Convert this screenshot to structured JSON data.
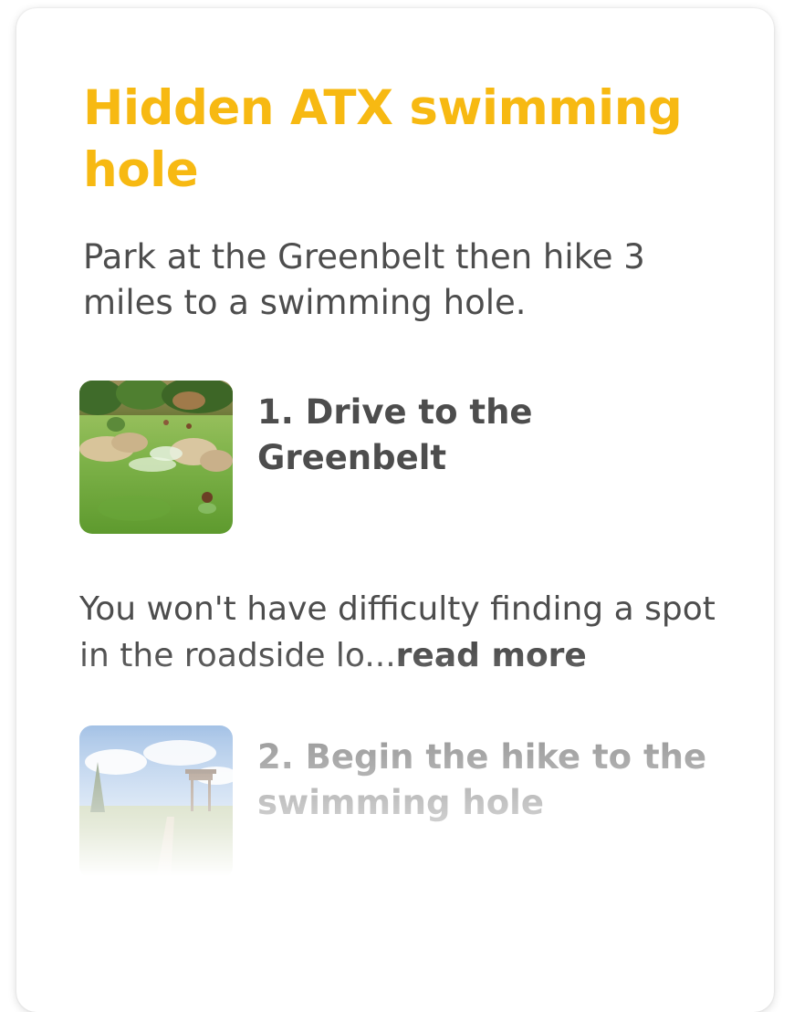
{
  "card": {
    "title": "Hidden ATX swimming hole",
    "description": "Park at the Greenbelt then hike 3 miles to a swimming hole."
  },
  "steps": [
    {
      "title": "1. Drive to the Greenbelt",
      "body": "You won't have difficulty finding a spot in the roadside lo...",
      "read_more": "read more",
      "thumbnail_icon": "swimming-hole-photo"
    },
    {
      "title": "2. Begin the hike to the swimming hole",
      "thumbnail_icon": "hiking-trail-photo"
    }
  ],
  "colors": {
    "accent": "#f7b912",
    "text": "#4d4d4d"
  }
}
